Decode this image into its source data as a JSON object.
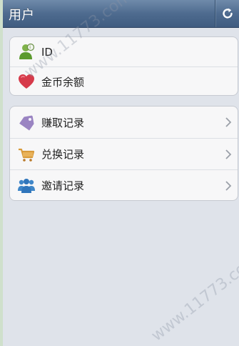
{
  "header": {
    "title": "用户",
    "refresh_icon": "refresh-icon"
  },
  "profile": {
    "items": [
      {
        "label": "ID",
        "icon": "user-icon"
      },
      {
        "label": "金币余额",
        "icon": "heart-icon"
      }
    ]
  },
  "records": {
    "items": [
      {
        "label": "赚取记录",
        "icon": "tag-icon"
      },
      {
        "label": "兑换记录",
        "icon": "cart-icon"
      },
      {
        "label": "邀请记录",
        "icon": "people-icon"
      }
    ]
  },
  "watermark": {
    "text": "www.11773.com"
  },
  "colors": {
    "navbar": "#4e6b8f",
    "background": "#dfe3ea",
    "card": "#f7f7f8"
  }
}
